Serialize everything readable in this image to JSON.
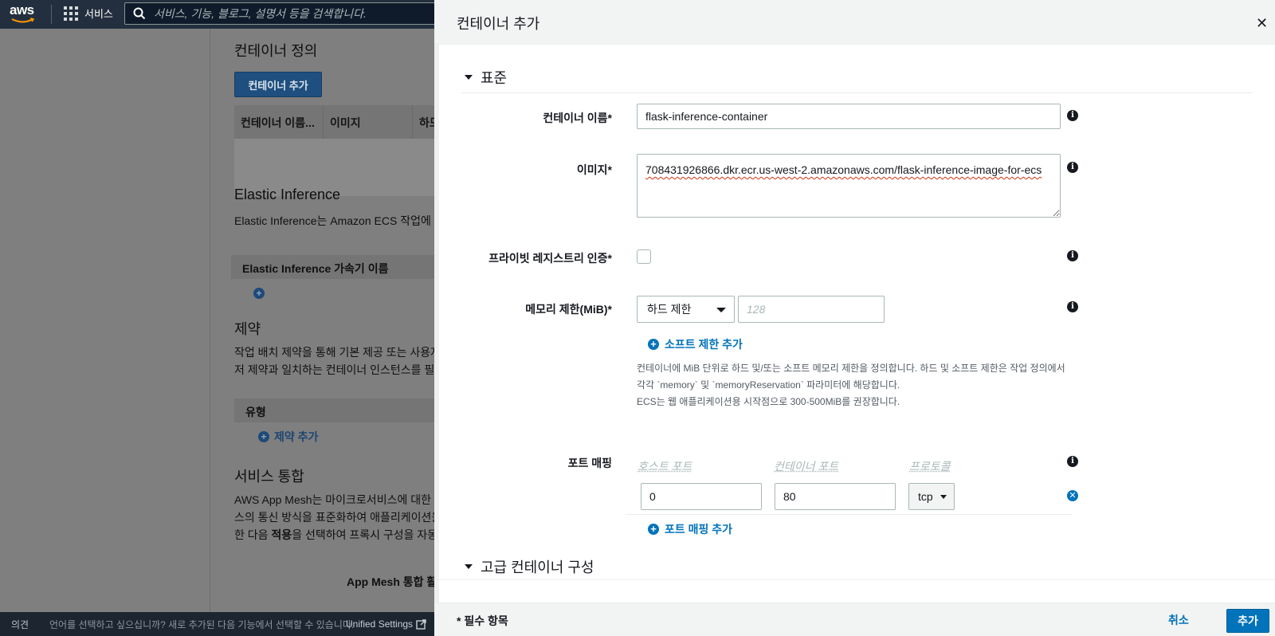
{
  "topnav": {
    "logo_text": "aws",
    "services_label": "서비스",
    "search_placeholder": "서비스, 기능, 블로그, 설명서 등을 검색합니다."
  },
  "background": {
    "container_def_title": "컨테이너 정의",
    "add_container_button": "컨테이너 추가",
    "table_headers": [
      "컨테이너 이름...",
      "이미지",
      "하드"
    ],
    "elastic_title": "Elastic Inference",
    "elastic_desc": "Elastic Inference는 Amazon ECS 작업에",
    "elastic_col": "Elastic Inference 가속기 이름",
    "constraint_title": "제약",
    "constraint_desc1": "작업 배치 제약을 통해 기본 제공 또는 사용자",
    "constraint_desc2": "저 제약과 일치하는 컨테이너 인스턴스를 필터",
    "type_col": "유형",
    "add_constraint": "제약 추가",
    "service_title": "서비스 통합",
    "service_desc1": "AWS App Mesh는 마이크로서비스에 대한",
    "service_desc2": "스의 통신 방식을 표준화하여 애플리케이션을",
    "service_desc3_pre": "한 다음 ",
    "service_desc3_bold": "적용",
    "service_desc3_post": "을 선택하여 프록시 구성을 자동",
    "app_mesh_label": "App Mesh 통합 활"
  },
  "feedback": {
    "label": "의견",
    "text": "언어를 선택하고 싶으십니까? 새로 추가된 다음 기능에서 선택할 수 있습니다.",
    "unified": "Unified Settings"
  },
  "panel": {
    "title": "컨테이너 추가",
    "standard_section": "표준",
    "fields": {
      "container_name_label": "컨테이너 이름*",
      "container_name_value": "flask-inference-container",
      "image_label": "이미지*",
      "image_value": "708431926866.dkr.ecr.us-west-2.amazonaws.com/flask-inference-image-for-ecs",
      "private_registry_label": "프라이빗 레지스트리 인증*",
      "memory_label": "메모리 제한(MiB)*",
      "memory_type": "하드 제한",
      "memory_placeholder": "128",
      "soft_limit_link": "소프트 제한 추가",
      "memory_help_1": "컨테이너에 MiB 단위로 하드 및/또는 소프트 메모리 제한을 정의합니다. 하드 및 소프트 제한은 작업 정의에서",
      "memory_help_2": "각각 `memory` 및 `memoryReservation` 파라미터에 해당합니다.",
      "memory_help_3": "ECS는 웹 애플리케이션용 시작점으로 300-500MiB를 권장합니다.",
      "port_mapping_label": "포트 매핑",
      "host_port_header": "호스트 포트",
      "container_port_header": "컨테이너 포트",
      "protocol_header": "프로토콜",
      "host_port_value": "0",
      "container_port_value": "80",
      "protocol_value": "tcp",
      "add_port_link": "포트 매핑 추가"
    },
    "advanced_section": "고급 컨테이너 구성",
    "footer": {
      "required_note": "* 필수 항목",
      "cancel": "취소",
      "add": "추가"
    }
  }
}
